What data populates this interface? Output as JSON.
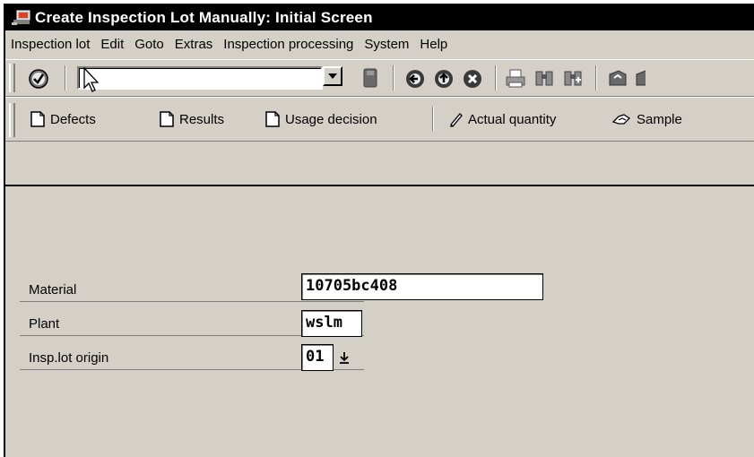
{
  "window": {
    "title": "Create Inspection Lot Manually: Initial Screen"
  },
  "menu": [
    "Inspection lot",
    "Edit",
    "Goto",
    "Extras",
    "Inspection processing",
    "System",
    "Help"
  ],
  "toolbar": {
    "command_field_value": "",
    "icons": [
      "enter-icon",
      "save-icon",
      "back-icon",
      "exit-icon",
      "cancel-icon",
      "print-icon",
      "find-icon",
      "find-next-icon",
      "first-page-icon"
    ]
  },
  "app_toolbar": {
    "defects": "Defects",
    "results": "Results",
    "usage_decision": "Usage decision",
    "actual_quantity": "Actual quantity",
    "sample": "Sample"
  },
  "form": {
    "material_label": "Material",
    "material_value": "10705bc408",
    "plant_label": "Plant",
    "plant_value": "wslm",
    "origin_label": "Insp.lot origin",
    "origin_value": "01"
  }
}
